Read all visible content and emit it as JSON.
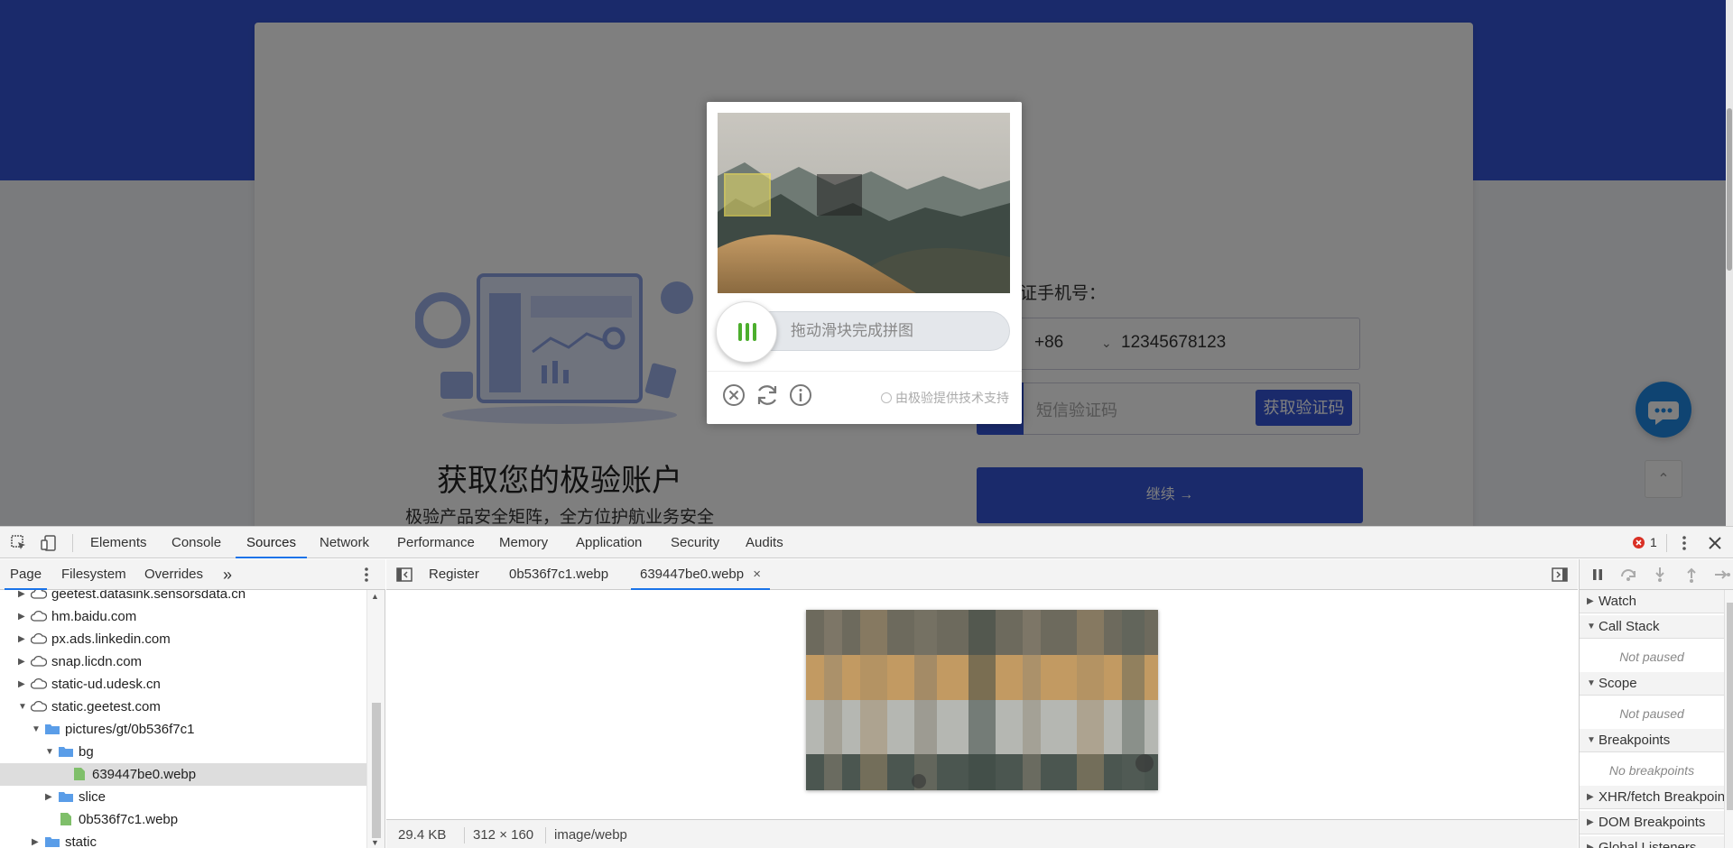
{
  "page": {
    "illustration_title": "获取您的极验账户",
    "illustration_subtitle": "极验产品安全矩阵，全方位护航业务安全",
    "phone_label": "证手机号：",
    "country_code": "+86",
    "phone_value": "12345678123",
    "sms_placeholder": "短信验证码",
    "sms_button": "获取验证码",
    "continue_button": "继续 →"
  },
  "captcha": {
    "slider_tip": "拖动滑块完成拼图",
    "powered_by": "由极验提供技术支持",
    "close_icon": "close-icon",
    "refresh_icon": "refresh-icon",
    "info_icon": "info-icon"
  },
  "devtools": {
    "main_tabs": [
      "Elements",
      "Console",
      "Sources",
      "Network",
      "Performance",
      "Memory",
      "Application",
      "Security",
      "Audits"
    ],
    "active_tab": "Sources",
    "more_tabs": "»",
    "error_count": "1",
    "navigator_tabs": [
      "Page",
      "Filesystem",
      "Overrides"
    ],
    "navigator_more": "»",
    "tree": [
      {
        "label": "geetest.datasink.sensorsdata.cn",
        "type": "domain"
      },
      {
        "label": "hm.baidu.com",
        "type": "domain"
      },
      {
        "label": "px.ads.linkedin.com",
        "type": "domain"
      },
      {
        "label": "snap.licdn.com",
        "type": "domain"
      },
      {
        "label": "static-ud.udesk.cn",
        "type": "domain"
      },
      {
        "label": "static.geetest.com",
        "type": "domain"
      },
      {
        "label": "pictures/gt/0b536f7c1",
        "type": "folder"
      },
      {
        "label": "bg",
        "type": "folder"
      },
      {
        "label": "639447be0.webp",
        "type": "file"
      },
      {
        "label": "slice",
        "type": "folder"
      },
      {
        "label": "0b536f7c1.webp",
        "type": "file"
      },
      {
        "label": "static",
        "type": "folder"
      }
    ],
    "editor_tabs": [
      {
        "label": "Register"
      },
      {
        "label": "0b536f7c1.webp"
      },
      {
        "label": "639447be0.webp"
      }
    ],
    "close_tab": "×",
    "status": {
      "size": "29.4 KB",
      "dimensions": "312 × 160",
      "mime": "image/webp"
    },
    "debugger_sections": [
      {
        "label": "Watch",
        "open": false
      },
      {
        "label": "Call Stack",
        "open": true,
        "message": "Not paused"
      },
      {
        "label": "Scope",
        "open": true,
        "message": "Not paused"
      },
      {
        "label": "Breakpoints",
        "open": true,
        "message": "No breakpoints"
      },
      {
        "label": "XHR/fetch Breakpoints",
        "open": false
      },
      {
        "label": "DOM Breakpoints",
        "open": false
      },
      {
        "label": "Global Listeners",
        "open": false
      }
    ]
  },
  "colors": {
    "brand_blue": "#3555d6",
    "devtools_active": "#1a73e8",
    "slider_green": "#4cae2d",
    "error_red": "#d93025"
  }
}
